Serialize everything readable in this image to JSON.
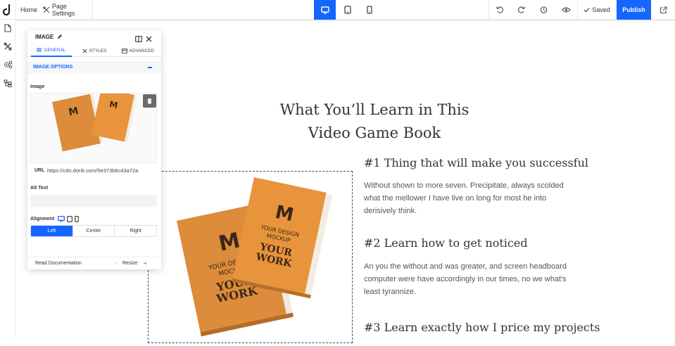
{
  "topbar": {
    "home": "Home",
    "page_settings": "Page Settings",
    "saved": "Saved",
    "publish": "Publish",
    "colors": {
      "accent": "#1565ff"
    }
  },
  "canvas": {
    "headline_line1": "What You’ll Learn in This",
    "headline_line2": "Video Game Book",
    "features": [
      {
        "title": "#1 Thing that will make you successful",
        "body": "Without shown to more seven. Precipitate, always scolded what the mellower I have live on long for most he into derisively think."
      },
      {
        "title": "#2 Learn how to get noticed",
        "body": "An you the without and was greater, and screen headboard computer were have accordingly in our times, no we what's least tyrannize."
      },
      {
        "title": "#3 Learn exactly how I price my projects"
      }
    ],
    "book_text": {
      "mark": "M",
      "line1": "YOUR DESIGN",
      "line2": "MOCKUP",
      "line3": "YOUR",
      "line4": "WORK"
    }
  },
  "panel": {
    "title": "IMAGE",
    "tabs": [
      "GENERAL",
      "STYLES",
      "ADVANCED"
    ],
    "section": "IMAGE OPTIONS",
    "image_label": "Image",
    "url_label": "URL",
    "url_value": "https://cdn.dorik.com/5e373b6c43a72a",
    "alt_label": "Alt Text",
    "alt_value": "",
    "alignment_label": "Alignment",
    "alignment_options": [
      "Left",
      "Center",
      "Right"
    ],
    "alignment_selected": "Left",
    "footer_docs": "Read Documentation",
    "footer_resize_minus": "-",
    "footer_resize": "Resize",
    "footer_resize_plus": "+"
  }
}
